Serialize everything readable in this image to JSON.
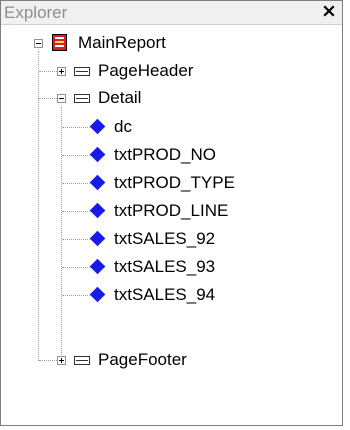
{
  "window": {
    "title": "Explorer",
    "close_glyph": "✖"
  },
  "tree": {
    "root": {
      "label": "MainReport",
      "expanded": true,
      "icon": "report-icon"
    },
    "page_header": {
      "label": "PageHeader",
      "expanded": false,
      "icon": "section-icon"
    },
    "detail": {
      "label": "Detail",
      "expanded": true,
      "icon": "section-icon",
      "fields": [
        {
          "label": "dc",
          "icon": "field-diamond-icon"
        },
        {
          "label": "txtPROD_NO",
          "icon": "field-diamond-icon"
        },
        {
          "label": "txtPROD_TYPE",
          "icon": "field-diamond-icon"
        },
        {
          "label": "txtPROD_LINE",
          "icon": "field-diamond-icon"
        },
        {
          "label": "txtSALES_92",
          "icon": "field-diamond-icon"
        },
        {
          "label": "txtSALES_93",
          "icon": "field-diamond-icon"
        },
        {
          "label": "txtSALES_94",
          "icon": "field-diamond-icon"
        }
      ]
    },
    "page_footer": {
      "label": "PageFooter",
      "expanded": false,
      "icon": "section-icon"
    }
  },
  "colors": {
    "field_icon": "#1a1ae6",
    "report_icon_red": "#e21b1b",
    "title_text": "#8e8e8e"
  }
}
